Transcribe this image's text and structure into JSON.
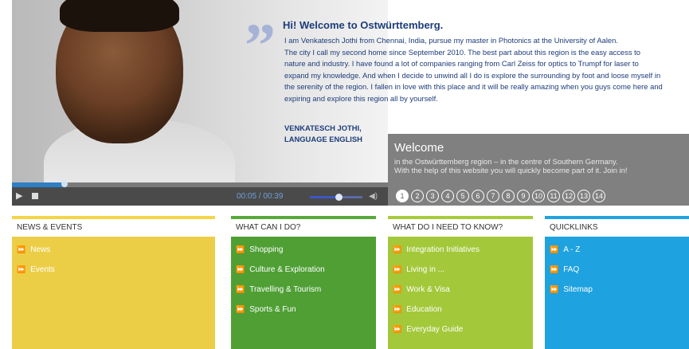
{
  "hero": {
    "quote_mark": "”",
    "welcome_title": "Hi! Welcome to Ostwürttemberg.",
    "welcome_lines": [
      "I am Venkatesch Jothi from Chennai, India, pursue my master in Photonics at the University of Aalen.",
      "The city I call my second home since September 2010. The best part about this region is the easy access to",
      "nature and industry. I have found a lot of companies ranging from Carl Zeiss for optics to Trumpf for laser to",
      "expand my knowledge. And when I decide to unwind all I do is explore the surrounding by foot and loose myself in",
      "the serenity of the region. I fallen in love with this place and it will be really amazing when you guys come here and",
      "expiring and explore this region all by yourself."
    ],
    "signature_name": "VENKATESCH JOTHI,",
    "signature_lang": "LANGUAGE ENGLISH"
  },
  "player": {
    "play_glyph": "▶",
    "time": "00:05 / 00:39",
    "speaker_glyph": "◀)",
    "progress": 0.14,
    "volume": 0.55
  },
  "panel": {
    "title": "Welcome",
    "line1": "in the Ostwürttemberg region – in the centre of Southern Germany.",
    "line2": "With the help of this website you will quickly become part of it. Join in!",
    "pages": [
      "1",
      "2",
      "3",
      "4",
      "5",
      "6",
      "7",
      "8",
      "9",
      "10",
      "11",
      "12",
      "13",
      "14"
    ],
    "active_page": 0
  },
  "tiles": [
    {
      "key": "news",
      "title": "NEWS & EVENTS",
      "bar": "#f2d648",
      "bg": "#ecce46",
      "items": [
        "News",
        "Events"
      ]
    },
    {
      "key": "whatcando",
      "title": "WHAT CAN I DO?",
      "bar": "#58a93a",
      "bg": "#4f9f35",
      "items": [
        "Shopping",
        "Culture & Exploration",
        "Travelling & Tourism",
        "Sports & Fun"
      ]
    },
    {
      "key": "needtoknow",
      "title": "WHAT DO I NEED TO KNOW?",
      "bar": "#a8cb3b",
      "bg": "#a3c83a",
      "items": [
        "Integration Initiatives",
        "Living in ...",
        "Work & Visa",
        "Education",
        "Everyday Guide"
      ]
    },
    {
      "key": "quicklinks",
      "title": "QUICKLINKS",
      "bar": "#22a3df",
      "bg": "#1ea2e0",
      "items": [
        "A - Z",
        "FAQ",
        "Sitemap"
      ]
    }
  ],
  "arrow_glyph": "⏩"
}
